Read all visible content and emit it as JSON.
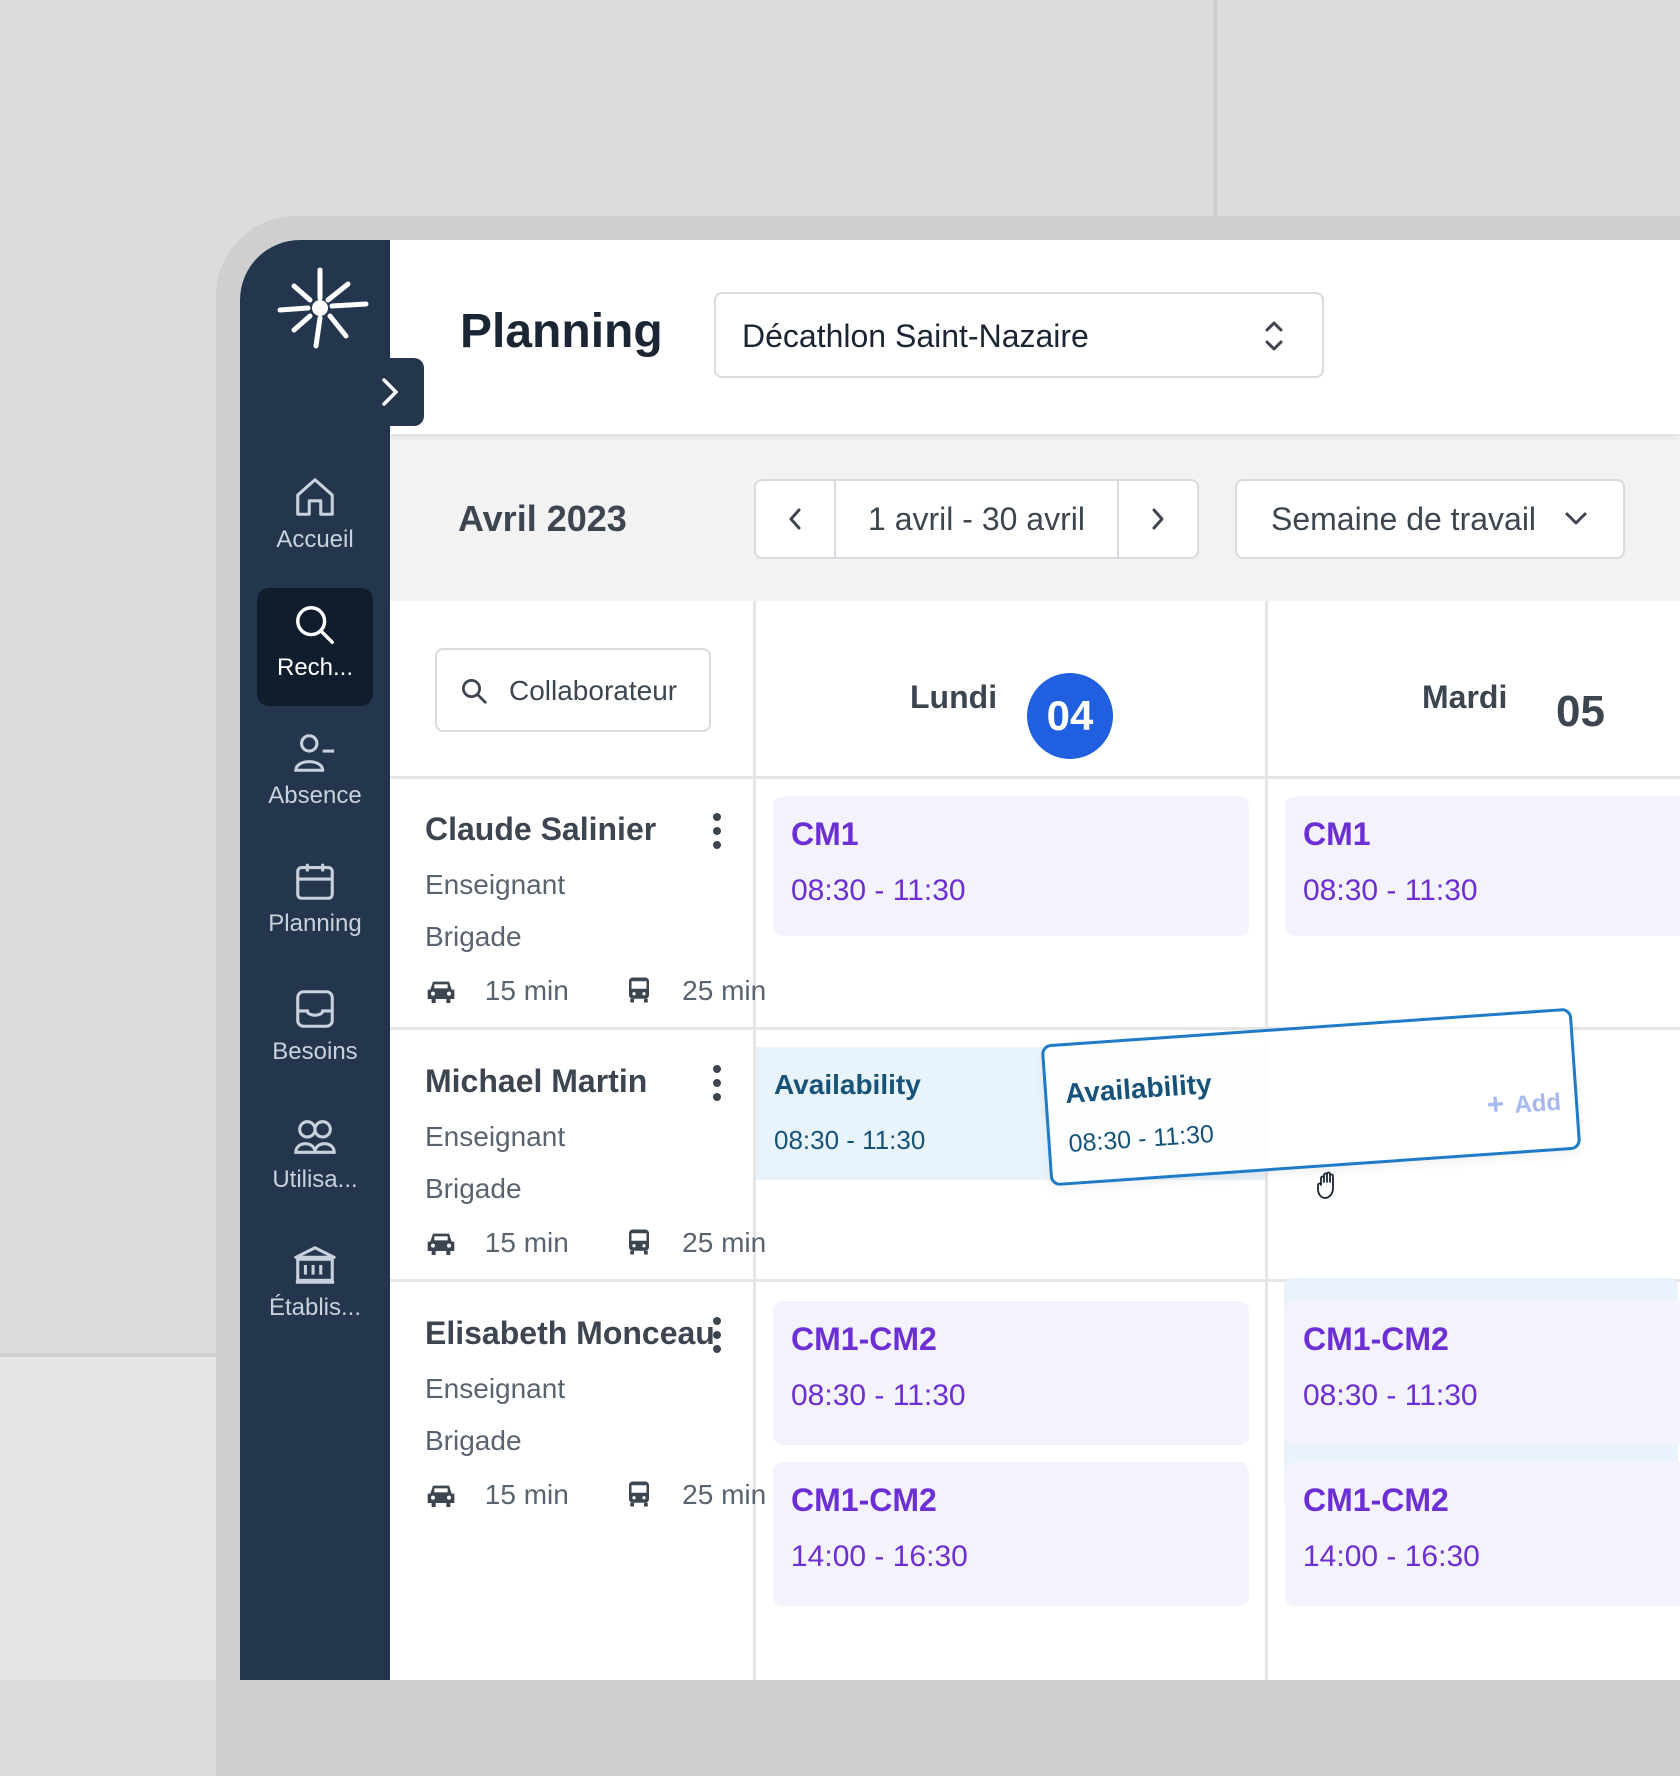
{
  "sidebar": {
    "items": [
      {
        "label": "Accueil",
        "icon": "home-icon"
      },
      {
        "label": "Rech...",
        "icon": "search-icon"
      },
      {
        "label": "Absence",
        "icon": "person-minus-icon"
      },
      {
        "label": "Planning",
        "icon": "calendar-icon"
      },
      {
        "label": "Besoins",
        "icon": "inbox-icon"
      },
      {
        "label": "Utilisa...",
        "icon": "users-icon"
      },
      {
        "label": "Établis...",
        "icon": "building-icon"
      }
    ],
    "active_index": 1
  },
  "header": {
    "title": "Planning",
    "store_select": "Décathlon Saint-Nazaire"
  },
  "toolbar": {
    "month": "Avril 2023",
    "range": "1 avril - 30 avril",
    "view": "Semaine de travail"
  },
  "search": {
    "placeholder": "Collaborateur"
  },
  "days": [
    {
      "name": "Lundi",
      "number": "04",
      "active": true
    },
    {
      "name": "Mardi",
      "number": "05",
      "active": false
    }
  ],
  "people": [
    {
      "name": "Claude Salinier",
      "role": "Enseignant",
      "team": "Brigade",
      "car": "15 min",
      "bus": "25 min"
    },
    {
      "name": "Michael Martin",
      "role": "Enseignant",
      "team": "Brigade",
      "car": "15 min",
      "bus": "25 min"
    },
    {
      "name": "Elisabeth Monceau",
      "role": "Enseignant",
      "team": "Brigade",
      "car": "15 min",
      "bus": "25 min"
    }
  ],
  "shifts": {
    "claude_mon": {
      "code": "CM1",
      "time": "08:30 - 11:30"
    },
    "claude_tue": {
      "code": "CM1",
      "time": "08:30 - 11:30"
    },
    "michael_mon": {
      "code": "Availability",
      "time": "08:30 - 11:30"
    },
    "elisabeth_mon_1": {
      "code": "CM1-CM2",
      "time": "08:30 - 11:30"
    },
    "elisabeth_tue_1": {
      "code": "CM1-CM2",
      "time": "08:30 - 11:30"
    },
    "elisabeth_mon_2": {
      "code": "CM1-CM2",
      "time": "14:00 - 16:30"
    },
    "elisabeth_tue_2": {
      "code": "CM1-CM2",
      "time": "14:00 - 16:30"
    }
  },
  "drag_card": {
    "code": "Availability",
    "time": "08:30 - 11:30",
    "add_label": "Add"
  },
  "colors": {
    "sidebar": "#23364d",
    "accent": "#1f5fe0",
    "shift_text": "#6c2fd6",
    "shift_bg": "#f4f2fc",
    "availability_text": "#16527a",
    "availability_bg": "#e8f3fb",
    "drag_border": "#1e7bc8"
  }
}
